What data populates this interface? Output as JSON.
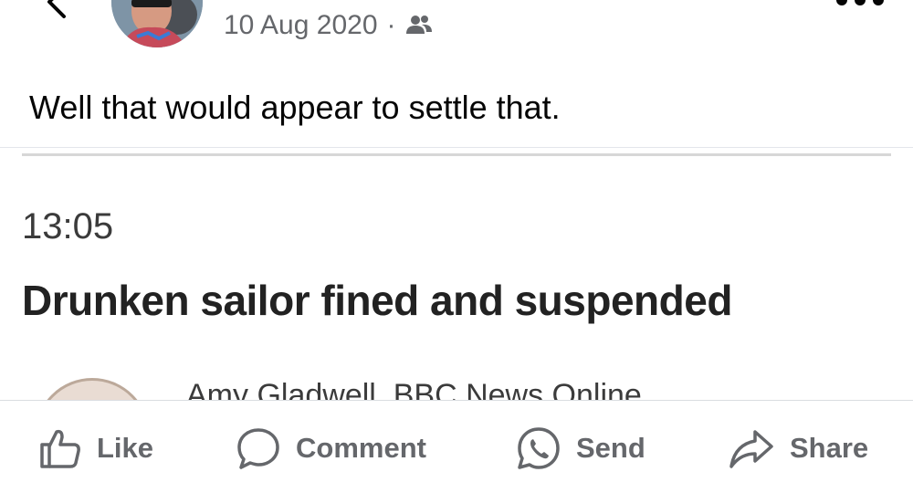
{
  "post": {
    "date": "10 Aug 2020",
    "separator": "·",
    "audience_icon": "friends-icon",
    "text": "Well that would appear to settle that."
  },
  "embed": {
    "time": "13:05",
    "headline": "Drunken sailor fined and suspended",
    "byline": "Amy Gladwell, BBC News Online"
  },
  "actions": {
    "like": "Like",
    "comment": "Comment",
    "send": "Send",
    "share": "Share"
  },
  "colors": {
    "secondary_text": "#65676b",
    "primary_text": "#050505",
    "divider": "#e4e6eb"
  }
}
